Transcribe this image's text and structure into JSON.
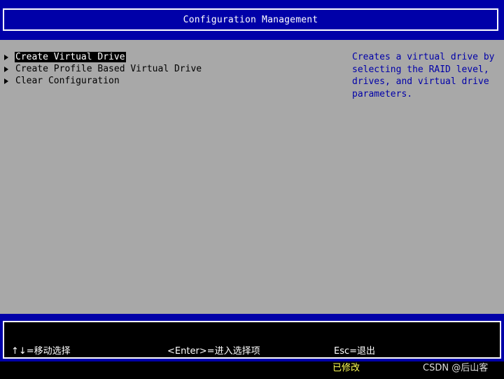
{
  "header": {
    "title": "Configuration Management"
  },
  "menu": {
    "items": [
      {
        "label": "Create Virtual Drive",
        "selected": true
      },
      {
        "label": "Create Profile Based Virtual Drive",
        "selected": false
      },
      {
        "label": "Clear Configuration",
        "selected": false
      }
    ]
  },
  "help": {
    "lines": [
      "Creates a virtual drive by",
      "selecting the RAID level,",
      "drives, and virtual drive",
      "parameters."
    ]
  },
  "footer": {
    "hints": [
      "↑↓=移动选择",
      "<Enter>=进入选择项",
      "Esc=退出"
    ]
  },
  "status": {
    "modified": "已修改"
  },
  "watermark": {
    "text": "CSDN @后山客"
  },
  "colors": {
    "bios_blue": "#0000a8",
    "panel_gray": "#a8a8a8",
    "help_text_blue": "#0000a8",
    "status_yellow": "#ffff55"
  },
  "icons": {
    "menu_bullet": "right-triangle-icon"
  }
}
